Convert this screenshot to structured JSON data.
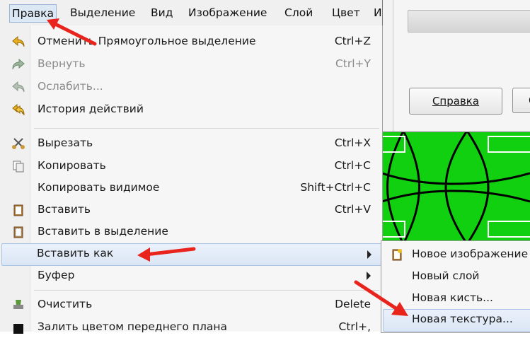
{
  "menubar": {
    "items": [
      "Правка",
      "Выделение",
      "Вид",
      "Изображение",
      "Слой",
      "Цвет",
      "И"
    ]
  },
  "dialog": {
    "help_label": "Справка",
    "second_button_label": "С"
  },
  "menu": {
    "items": [
      {
        "label": "Отменить Прямоугольное выделение",
        "shortcut": "Ctrl+Z",
        "icon": "undo-icon"
      },
      {
        "label": "Вернуть",
        "shortcut": "Ctrl+Y",
        "icon": "redo-icon",
        "disabled": true
      },
      {
        "label": "Ослабить...",
        "shortcut": "",
        "icon": "fade-icon",
        "disabled": true
      },
      {
        "label": "История действий",
        "shortcut": "",
        "icon": "history-icon"
      },
      {
        "label": "Вырезать",
        "shortcut": "Ctrl+X",
        "icon": "scissors-icon"
      },
      {
        "label": "Копировать",
        "shortcut": "Ctrl+C",
        "icon": "copy-icon"
      },
      {
        "label": "Копировать видимое",
        "shortcut": "Shift+Ctrl+C",
        "icon": ""
      },
      {
        "label": "Вставить",
        "shortcut": "Ctrl+V",
        "icon": "paste-icon"
      },
      {
        "label": "Вставить в выделение",
        "shortcut": "",
        "icon": "paste-into-icon"
      },
      {
        "label": "Вставить как",
        "shortcut": "",
        "icon": "",
        "submenu": true
      },
      {
        "label": "Буфер",
        "shortcut": "",
        "icon": "",
        "submenu": true
      },
      {
        "label": "Очистить",
        "shortcut": "Delete",
        "icon": "clear-icon"
      },
      {
        "label": "Залить цветом переднего плана",
        "shortcut": "Ctrl+,",
        "icon": "fill-fg-icon"
      }
    ]
  },
  "submenu": {
    "items": [
      {
        "label": "Новое изображение",
        "icon": "new-image-icon"
      },
      {
        "label": "Новый слой",
        "icon": ""
      },
      {
        "label": "Новая кисть...",
        "icon": ""
      },
      {
        "label": "Новая текстура...",
        "icon": ""
      }
    ]
  },
  "colors": {
    "canvas_green": "#10d010",
    "highlight": "#dbe6f5",
    "annotation_arrow": "#e8241c"
  }
}
